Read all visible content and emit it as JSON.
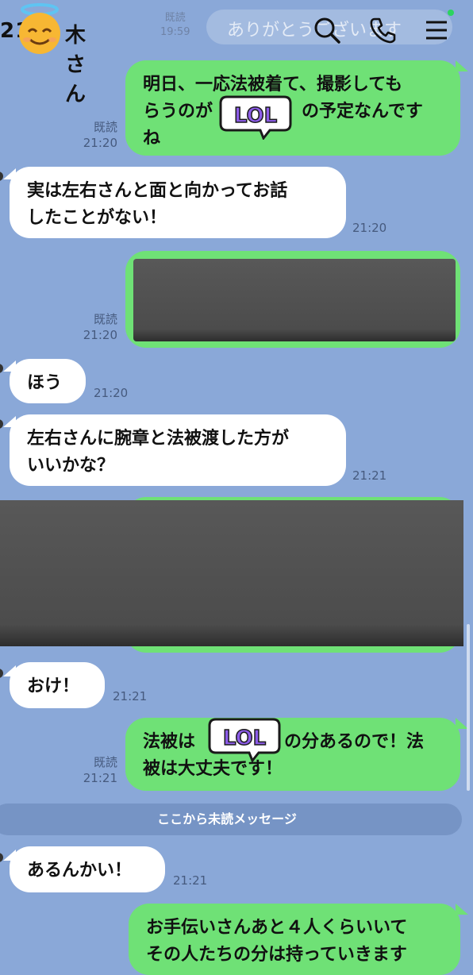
{
  "header": {
    "title_prefix": "21",
    "title_suffix": "木さん",
    "preview_time": "19:59",
    "preview_read": "既読",
    "preview_text": "ありがとうございます",
    "icons": [
      "search-icon",
      "phone-icon",
      "menu-icon"
    ],
    "status_color": "#2bd45f"
  },
  "messages": [
    {
      "dir": "out",
      "text_line1": "明日、一応法被着て、撮影しても",
      "text_line2a": "らうのが",
      "text_line2b": "の予定なんです",
      "text_line3": "ね",
      "read": "既読",
      "time": "21:20",
      "sticker": "LOL"
    },
    {
      "dir": "in",
      "text_line1": "実は左右さんと面と向かってお話",
      "text_line2": "したことがない！",
      "time": "21:20"
    },
    {
      "dir": "out",
      "redacted": true,
      "read": "既読",
      "time": "21:20"
    },
    {
      "dir": "in",
      "text_line1": "ほう",
      "time": "21:20"
    },
    {
      "dir": "in",
      "text_line1": "左右さんに腕章と法被渡した方が",
      "text_line2": "いいかな？",
      "time": "21:21"
    },
    {
      "dir": "out",
      "redacted": true
    },
    {
      "dir": "in",
      "text_line1": "おけ！",
      "time": "21:21"
    },
    {
      "dir": "out",
      "text_line1a": "法被は",
      "text_line1b": "の分あるので！法",
      "text_line2": "被は大丈夫です！",
      "read": "既読",
      "time": "21:21",
      "sticker": "LOL"
    },
    {
      "dir": "in",
      "text_line1": "あるんかい！",
      "time": "21:21"
    },
    {
      "dir": "out",
      "text_line1": "お手伝いさんあと４人くらいいて",
      "text_line2": "その人たちの分は持っていきます"
    }
  ],
  "divider": "ここから未読メッセージ",
  "colors": {
    "background": "#8aa8d8",
    "outgoing": "#6fe176",
    "incoming": "#ffffff"
  }
}
